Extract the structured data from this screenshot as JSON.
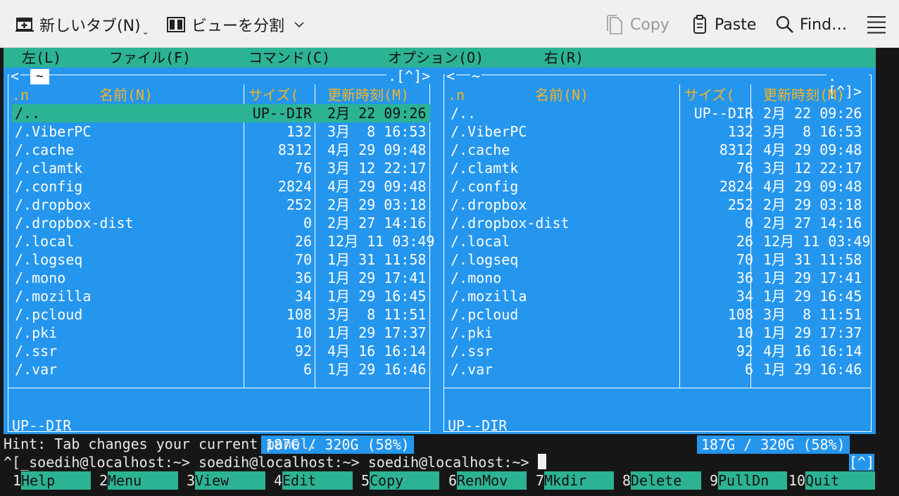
{
  "toolbar": {
    "new_tab": "新しいタブ(N)",
    "split_view": "ビューを分割",
    "copy": "Copy",
    "paste": "Paste",
    "find": "Find…",
    "icons": [
      "new-tab-icon",
      "split-view-icon",
      "chevron-down-icon",
      "copy-icon",
      "paste-icon",
      "search-icon",
      "hamburger-menu-icon"
    ]
  },
  "menubar": [
    "左(L)",
    "ファイル(F)",
    "コマンド(C)",
    "オプション(O)",
    "右(R)"
  ],
  "headers": {
    "name_short": ".n",
    "name": "名前(N)",
    "size": "サイズ(",
    "mtime": "更新時刻(M)"
  },
  "left_panel": {
    "path": "~",
    "scroll_indicator": ".[^]>",
    "left_arrow": "<",
    "selected_info": "UP--DIR",
    "disk": "187G / 320G (58%)",
    "files": [
      {
        "name": "/..",
        "size": "UP--DIR",
        "mtime": "2月 22 09:26",
        "selected": true
      },
      {
        "name": "/.ViberPC",
        "size": "132",
        "mtime": "3月  8 16:53"
      },
      {
        "name": "/.cache",
        "size": "8312",
        "mtime": "4月 29 09:48"
      },
      {
        "name": "/.clamtk",
        "size": "76",
        "mtime": "3月 12 22:17"
      },
      {
        "name": "/.config",
        "size": "2824",
        "mtime": "4月 29 09:48"
      },
      {
        "name": "/.dropbox",
        "size": "252",
        "mtime": "2月 29 03:18"
      },
      {
        "name": "/.dropbox-dist",
        "size": "0",
        "mtime": "2月 27 14:16"
      },
      {
        "name": "/.local",
        "size": "26",
        "mtime": "12月 11 03:49"
      },
      {
        "name": "/.logseq",
        "size": "70",
        "mtime": "1月 31 11:58"
      },
      {
        "name": "/.mono",
        "size": "36",
        "mtime": "1月 29 17:41"
      },
      {
        "name": "/.mozilla",
        "size": "34",
        "mtime": "1月 29 16:45"
      },
      {
        "name": "/.pcloud",
        "size": "108",
        "mtime": "3月  8 11:51"
      },
      {
        "name": "/.pki",
        "size": "10",
        "mtime": "1月 29 17:37"
      },
      {
        "name": "/.ssr",
        "size": "92",
        "mtime": "4月 16 16:14"
      },
      {
        "name": "/.var",
        "size": "6",
        "mtime": "1月 29 16:46"
      }
    ]
  },
  "right_panel": {
    "path": "~",
    "scroll_indicator": ".[^]>",
    "left_arrow": "<",
    "selected_info": "UP--DIR",
    "disk": "187G / 320G (58%)",
    "files": [
      {
        "name": "/..",
        "size": "UP--DIR",
        "mtime": "2月 22 09:26"
      },
      {
        "name": "/.ViberPC",
        "size": "132",
        "mtime": "3月  8 16:53"
      },
      {
        "name": "/.cache",
        "size": "8312",
        "mtime": "4月 29 09:48"
      },
      {
        "name": "/.clamtk",
        "size": "76",
        "mtime": "3月 12 22:17"
      },
      {
        "name": "/.config",
        "size": "2824",
        "mtime": "4月 29 09:48"
      },
      {
        "name": "/.dropbox",
        "size": "252",
        "mtime": "2月 29 03:18"
      },
      {
        "name": "/.dropbox-dist",
        "size": "0",
        "mtime": "2月 27 14:16"
      },
      {
        "name": "/.local",
        "size": "26",
        "mtime": "12月 11 03:49"
      },
      {
        "name": "/.logseq",
        "size": "70",
        "mtime": "1月 31 11:58"
      },
      {
        "name": "/.mono",
        "size": "36",
        "mtime": "1月 29 17:41"
      },
      {
        "name": "/.mozilla",
        "size": "34",
        "mtime": "1月 29 16:45"
      },
      {
        "name": "/.pcloud",
        "size": "108",
        "mtime": "3月  8 11:51"
      },
      {
        "name": "/.pki",
        "size": "10",
        "mtime": "1月 29 17:37"
      },
      {
        "name": "/.ssr",
        "size": "92",
        "mtime": "4月 16 16:14"
      },
      {
        "name": "/.var",
        "size": "6",
        "mtime": "1月 29 16:46"
      }
    ]
  },
  "hint": "Hint: Tab changes your current panel.",
  "prompt": "^[_soedih@localhost:~> soedih@localhost:~> soedih@localhost:~> ",
  "history_button": "[^]",
  "function_keys": [
    {
      "num": "1",
      "label": "Help"
    },
    {
      "num": "2",
      "label": "Menu"
    },
    {
      "num": "3",
      "label": "View"
    },
    {
      "num": "4",
      "label": "Edit"
    },
    {
      "num": "5",
      "label": "Copy"
    },
    {
      "num": "6",
      "label": "RenMov"
    },
    {
      "num": "7",
      "label": "Mkdir"
    },
    {
      "num": "8",
      "label": "Delete"
    },
    {
      "num": "9",
      "label": "PullDn"
    },
    {
      "num": "10",
      "label": "Quit"
    }
  ],
  "colors": {
    "panel_bg": "#2496ee",
    "menu_bg": "#2bb394",
    "header_fg": "#f5b323",
    "terminal_bg": "#161616"
  }
}
